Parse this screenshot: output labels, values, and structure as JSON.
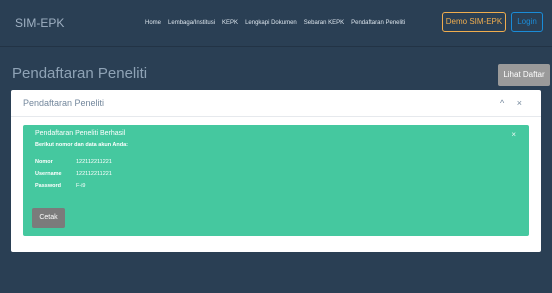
{
  "brand": "SIM-EPK",
  "nav": [
    "Home",
    "Lembaga/Institusi",
    "KEPK",
    "Lengkapi Dokumen",
    "Sebaran KEPK",
    "Pendaftaran Peneliti"
  ],
  "buttons": {
    "demo": "Demo SIM-EPK",
    "login": "Login",
    "list": "Lihat Daftar",
    "print": "Cetak"
  },
  "page_title": "Pendaftaran Peneliti",
  "panel": {
    "title": "Pendaftaran Peneliti",
    "tools": "^ ×"
  },
  "alert": {
    "title": "Pendaftaran Peneliti Berhasil",
    "subtitle": "Berikut nomor dan data akun Anda:",
    "close": "×",
    "rows": [
      {
        "label": "Nomor",
        "value": "122112211221"
      },
      {
        "label": "Username",
        "value": "122112211221"
      },
      {
        "label": "Password",
        "value": "F-i9"
      }
    ]
  }
}
